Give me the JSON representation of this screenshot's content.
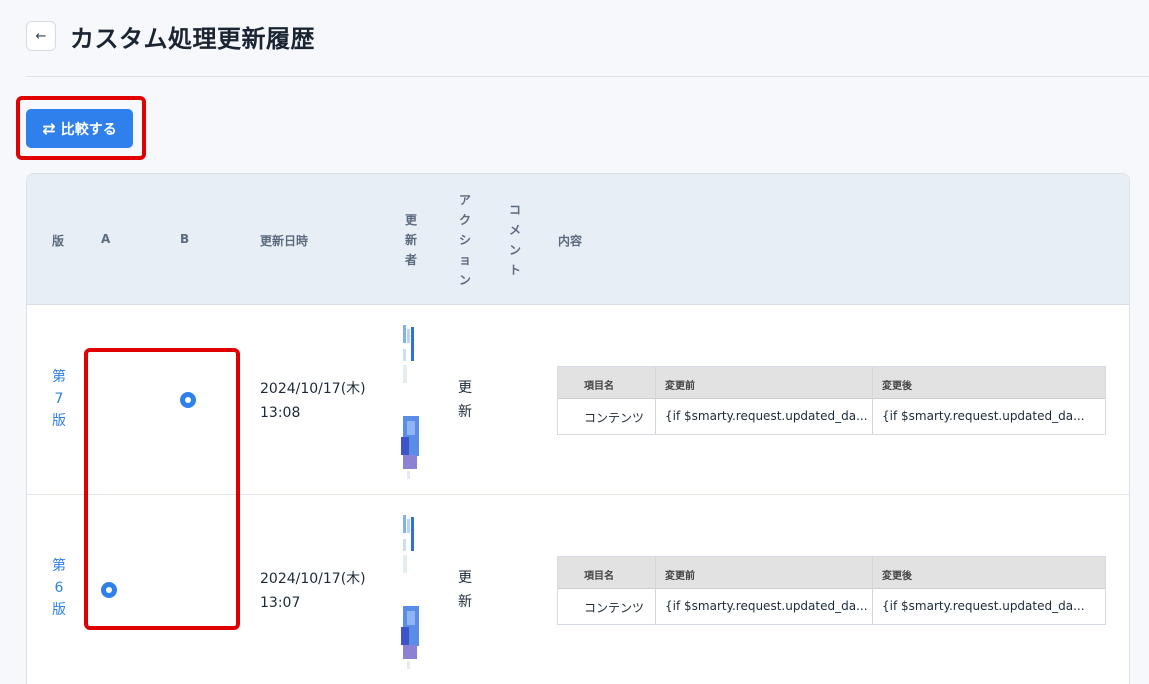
{
  "header": {
    "back_icon": "←",
    "title": "カスタム処理更新履歴"
  },
  "toolbar": {
    "compare_icon": "⇄",
    "compare_label": "比較する"
  },
  "table": {
    "columns": {
      "version": "版",
      "a": "A",
      "b": "B",
      "datetime": "更新日時",
      "updater": "更新者",
      "action": "アクション",
      "comment": "コメント",
      "content": "内容"
    },
    "rows": [
      {
        "version": "第7版",
        "selected": "B",
        "date": "2024/10/17(木)",
        "time": "13:08",
        "action": "更新",
        "diff": {
          "headers": [
            "項目名",
            "変更前",
            "変更後"
          ],
          "item": "コンテンツ",
          "before": "{if $smarty.request.updated_da...",
          "after": "{if $smarty.request.updated_da..."
        }
      },
      {
        "version": "第6版",
        "selected": "A",
        "date": "2024/10/17(木)",
        "time": "13:07",
        "action": "更新",
        "diff": {
          "headers": [
            "項目名",
            "変更前",
            "変更後"
          ],
          "item": "コンテンツ",
          "before": "{if $smarty.request.updated_da...",
          "after": "{if $smarty.request.updated_da..."
        }
      }
    ]
  }
}
